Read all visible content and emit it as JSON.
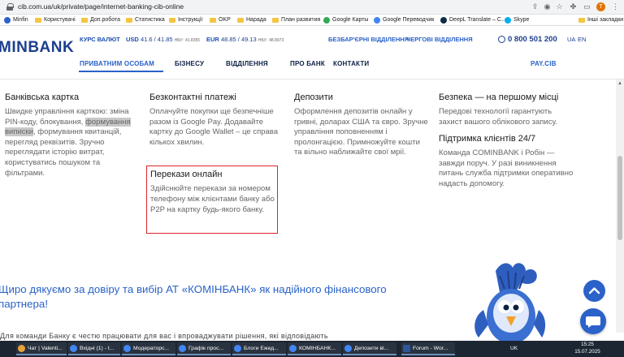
{
  "browser": {
    "url": "cib.com.ua/uk/private/page/internet-banking-cib-online",
    "bookmarks": [
      {
        "label": "Minfin",
        "type": "fav",
        "color": "#2a62c9"
      },
      {
        "label": "Користувачі",
        "type": "folder"
      },
      {
        "label": "Доп.робота",
        "type": "folder"
      },
      {
        "label": "Статистика",
        "type": "folder"
      },
      {
        "label": "Інструкції",
        "type": "folder"
      },
      {
        "label": "OKP",
        "type": "folder"
      },
      {
        "label": "Нарада",
        "type": "folder"
      },
      {
        "label": "План развития",
        "type": "folder"
      },
      {
        "label": "Google Карты",
        "type": "fav",
        "color": "#34a853"
      },
      {
        "label": "Google Переводчик",
        "type": "fav",
        "color": "#4285f4"
      },
      {
        "label": "DeepL Translate – С...",
        "type": "fav",
        "color": "#0f2b46"
      },
      {
        "label": "Skype",
        "type": "fav",
        "color": "#00aff0"
      }
    ],
    "other_bookmarks": "Інші закладки"
  },
  "header": {
    "logo": "MINBANK",
    "rates_label": "КУРС ВАЛЮТ",
    "usd": {
      "code": "USD",
      "value": "41.6 / 41.85",
      "nbu_label": "НБУ:",
      "nbu": "41.8355"
    },
    "eur": {
      "code": "EUR",
      "value": "48.85 / 49.13",
      "nbu_label": "НБУ:",
      "nbu": "48.8973"
    },
    "link_branches": "БЕЗБАР'ЄРНІ ВІДДІЛЕННЯ",
    "link_queue": "ЧЕРГОВІ ВІДДІЛЕННЯ",
    "phone": "0 800 501 200",
    "lang_ua": "UA",
    "lang_en": "EN",
    "nav": [
      "ПРИВАТНИМ ОСОБАМ",
      "БІЗНЕСУ",
      "ВІДДІЛЕННЯ",
      "ПРО БАНК",
      "КОНТАКТИ"
    ],
    "paycib": "PAY.CIB"
  },
  "content": {
    "col1": {
      "title": "Банківська картка",
      "text_a": "Швидке управління карткою: зміна PIN-коду, блокування, ",
      "text_hl": "формування виписки",
      "text_b": ", формування квитанцій, перегляд реквізитів. Зручно переглядати історію витрат, користуватись пошуком та фільтрами."
    },
    "col2": {
      "title": "Безконтактні платежі",
      "text": "Оплачуйте покупки ще безпечніше разом із Google Pay. Додавайте картку до Google Wallet – це справа кількох хвилин."
    },
    "box": {
      "title": "Перекази онлайн",
      "text": "Здійснюйте перекази за номером телефону між клієнтами банку або P2P на картку будь-якого банку."
    },
    "col3": {
      "title": "Депозити",
      "text": "Оформлення депозитів онлайн у гривні, доларах США та євро. Зручне управління поповненням і пролонгацією. Примножуйте кошти та вільно наближайте свої мрії."
    },
    "col4": {
      "title": "Безпека — на першому місці",
      "text": "Передові технології гарантують захист вашого облікового запису.",
      "title2": "Підтримка клієнтів 24/7",
      "text2": "Команда COMINBANK і Робін — завжди поруч. У разі виникнення питань служба підтримки оперативно надасть допомогу."
    },
    "thanks": "Щиро дякуємо за довіру та вибір АТ «КОМІНБАНК» як надійного фінансового партнера!",
    "bottom": "Для команди Банку є честю працювати для вас і впроваджувати рішення, які відповідають"
  },
  "taskbar": {
    "tasks": [
      {
        "label": "Чат | Valenti...",
        "color": "#e8a23a"
      },
      {
        "label": "Вхідні (1) - t...",
        "color": "#4285f4"
      },
      {
        "label": "Модераторс...",
        "color": "#4285f4"
      },
      {
        "label": "Графік прос...",
        "color": "#4285f4"
      },
      {
        "label": "Блоги Ежед...",
        "color": "#4285f4"
      },
      {
        "label": "КОМІНБАНК...",
        "color": "#4285f4"
      },
      {
        "label": "Депозити ві...",
        "color": "#4285f4"
      },
      {
        "label": "Forum - Wor...",
        "color": "#2b579a"
      }
    ],
    "lang": "UK",
    "time": "15:25",
    "date": "15.07.2025"
  }
}
